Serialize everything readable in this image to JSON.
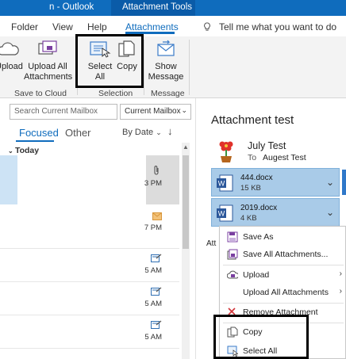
{
  "app": {
    "title_fragment": "n - Outlook",
    "contextual_tab": "Attachment Tools"
  },
  "tabs": {
    "items": [
      "Folder",
      "View",
      "Help",
      "Attachments"
    ],
    "active": "Attachments",
    "tell_me": "Tell me what you want to do"
  },
  "ribbon": {
    "upload": "Upload",
    "upload_all_1": "Upload All",
    "upload_all_2": "Attachments",
    "save_to_cloud": "Save to Cloud",
    "select_all_1": "Select",
    "select_all_2": "All",
    "copy": "Copy",
    "selection": "Selection",
    "show_message_1": "Show",
    "show_message_2": "Message",
    "message": "Message"
  },
  "list": {
    "search_placeholder": "Search Current Mailbox",
    "mailbox_scope": "Current Mailbox",
    "focused": "Focused",
    "other": "Other",
    "sort": "By Date",
    "sort_arrow": "↓",
    "group": "Today",
    "rows": [
      {
        "time": "3 PM"
      },
      {
        "time": "7 PM"
      },
      {
        "time": "5 AM"
      },
      {
        "time": "5 AM"
      },
      {
        "time": "5 AM"
      }
    ]
  },
  "reading": {
    "subject": "Attachment test",
    "sender": "July Test",
    "to_label": "To",
    "recipient": "Augest Test",
    "attachments": [
      {
        "name": "444.docx",
        "size": "15 KB"
      },
      {
        "name": "2019.docx",
        "size": "4 KB"
      }
    ],
    "label_fragment": "Att"
  },
  "context_menu": {
    "items": [
      "Save As",
      "Save All Attachments...",
      "Upload",
      "Upload All Attachments",
      "Remove Attachment",
      "Copy",
      "Select All"
    ]
  },
  "colors": {
    "accent": "#0f6cbd",
    "attachment_bg": "#a9cbe8",
    "highlight_border": "#000000"
  }
}
